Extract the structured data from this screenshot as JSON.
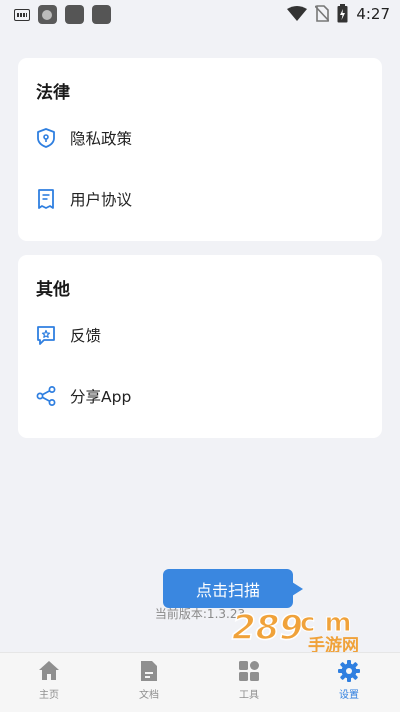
{
  "status_bar": {
    "time": "4:27"
  },
  "sections": [
    {
      "title": "法律",
      "items": [
        {
          "label": "隐私政策",
          "icon": "shield-icon"
        },
        {
          "label": "用户协议",
          "icon": "document-icon"
        }
      ]
    },
    {
      "title": "其他",
      "items": [
        {
          "label": "反馈",
          "icon": "feedback-icon"
        },
        {
          "label": "分享App",
          "icon": "share-icon"
        }
      ]
    }
  ],
  "scan_button": {
    "label": "点击扫描"
  },
  "version_text": "当前版本:1.3.23",
  "watermark": {
    "text": "289",
    "suffix": "c  m",
    "sub": "手游网"
  },
  "bottom_nav": [
    {
      "label": "主页",
      "icon": "home-icon"
    },
    {
      "label": "文档",
      "icon": "document-icon"
    },
    {
      "label": "工具",
      "icon": "grid-icon"
    },
    {
      "label": "设置",
      "icon": "gear-icon",
      "active": true
    }
  ],
  "colors": {
    "accent": "#2f7fe0",
    "background": "#f1f2f6",
    "card": "#ffffff",
    "tooltip": "#3a87e0"
  }
}
